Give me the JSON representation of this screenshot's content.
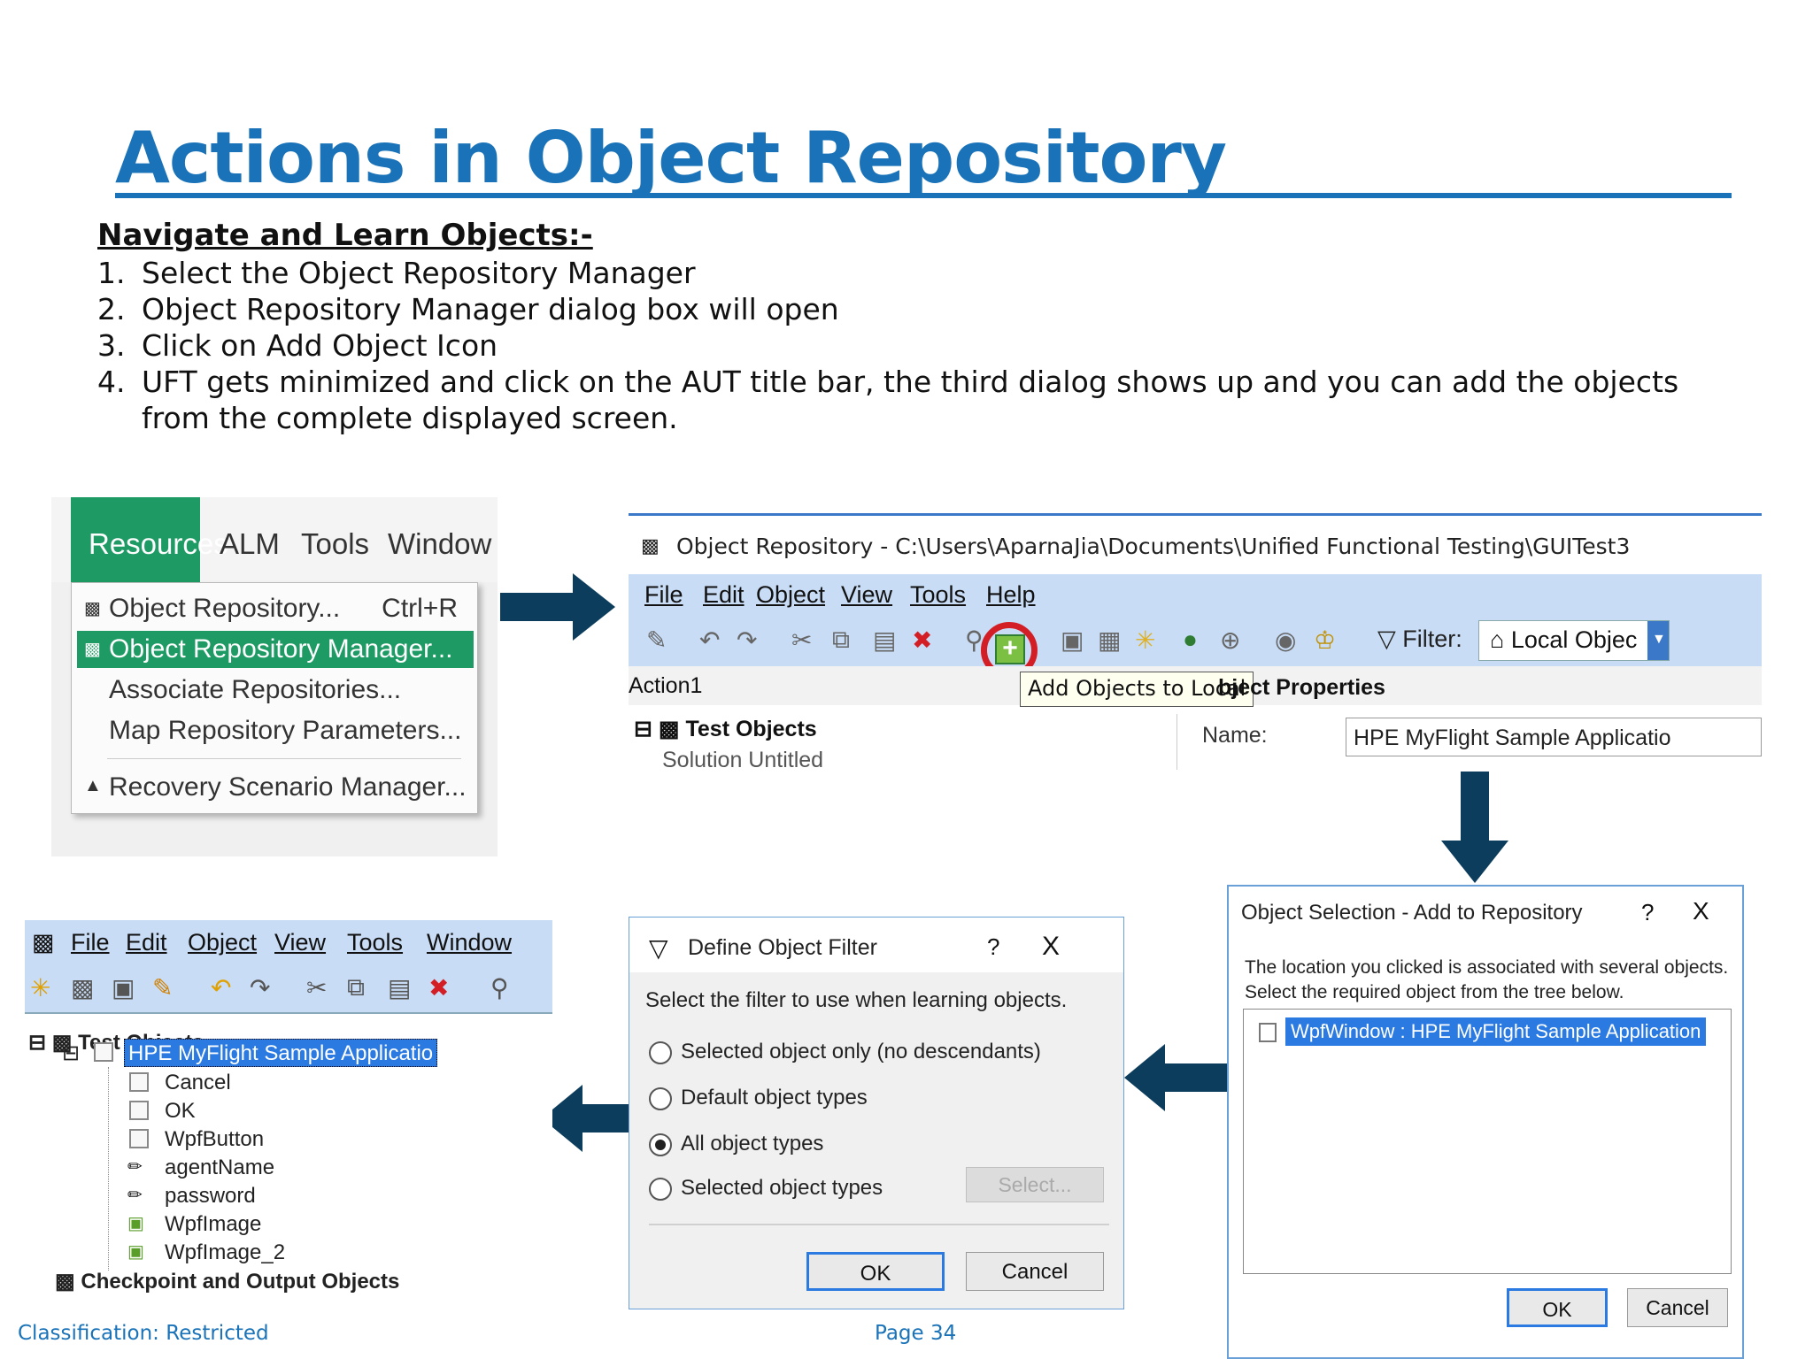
{
  "title": "Actions in Object Repository",
  "subheading": "Navigate and Learn Objects:-",
  "steps": [
    {
      "num": "1.",
      "text": "Select the Object Repository Manager"
    },
    {
      "num": "2.",
      "text": "Object Repository Manager dialog box will open"
    },
    {
      "num": "3.",
      "text": "Click on Add Object Icon"
    },
    {
      "num": "4.",
      "text": "UFT gets minimized and click on the AUT title bar, the third dialog shows up and you can add the objects from the complete displayed screen."
    }
  ],
  "footer": {
    "classification": "Classification: Restricted",
    "page": "Page 34"
  },
  "colors": {
    "title": "#1a73b8",
    "arrow": "#0c3d5c",
    "menu_green": "#1e9b64",
    "toolbar_blue": "#c8dcf5",
    "highlight": "#2a7ae2",
    "circle_red": "#d41e25"
  },
  "menu_panel": {
    "menubar": [
      "Resources",
      "ALM",
      "Tools",
      "Window"
    ],
    "items": [
      {
        "label": "Object Repository...",
        "shortcut": "Ctrl+R"
      },
      {
        "label": "Object Repository Manager...",
        "shortcut": ""
      },
      {
        "label": "Associate Repositories...",
        "shortcut": ""
      },
      {
        "label": "Map Repository Parameters...",
        "shortcut": ""
      },
      {
        "label": "Recovery Scenario Manager...",
        "shortcut": ""
      }
    ]
  },
  "repo_window": {
    "title": "Object Repository - C:\\Users\\AparnaJia\\Documents\\Unified Functional Testing\\GUITest3",
    "menus": [
      "File",
      "Edit",
      "Object",
      "View",
      "Tools",
      "Help"
    ],
    "filter_label": "Filter:",
    "filter_value": "Local Objec",
    "action": "Action1",
    "tooltip": "Add Objects to Local",
    "object_properties": "bject Properties",
    "tree_root": "Test Objects",
    "tree_child": "Solution Untitled",
    "name_label": "Name:",
    "name_value": "HPE MyFlight Sample Applicatio"
  },
  "selection_dialog": {
    "title": "Object Selection - Add to Repository",
    "help": "?",
    "close": "X",
    "message_line1": "The location you clicked is associated with several objects.",
    "message_line2": "Select the required object from the tree below.",
    "node": "WpfWindow : HPE MyFlight Sample Application",
    "ok": "OK",
    "cancel": "Cancel"
  },
  "filter_dialog": {
    "title": "Define Object Filter",
    "help": "?",
    "close": "X",
    "prompt": "Select the filter to use when learning objects.",
    "options": [
      {
        "label": "Selected object only (no descendants)",
        "selected": false
      },
      {
        "label": "Default object types",
        "selected": false
      },
      {
        "label": "All object types",
        "selected": true
      },
      {
        "label": "Selected object types",
        "selected": false
      }
    ],
    "select_button": "Select...",
    "ok": "OK",
    "cancel": "Cancel"
  },
  "tree_panel": {
    "menus": [
      "File",
      "Edit",
      "Object",
      "View",
      "Tools",
      "Window"
    ],
    "root": "Test Objects",
    "app": "HPE MyFlight Sample Applicatio",
    "children": [
      {
        "label": "Cancel",
        "icon": "checkbox-icon"
      },
      {
        "label": "OK",
        "icon": "checkbox-icon"
      },
      {
        "label": "WpfButton",
        "icon": "checkbox-icon"
      },
      {
        "label": "agentName",
        "icon": "pencil-icon"
      },
      {
        "label": "password",
        "icon": "pencil-icon"
      },
      {
        "label": "WpfImage",
        "icon": "image-icon"
      },
      {
        "label": "WpfImage_2",
        "icon": "image-icon"
      }
    ],
    "checkpoint": "Checkpoint and Output Objects"
  }
}
